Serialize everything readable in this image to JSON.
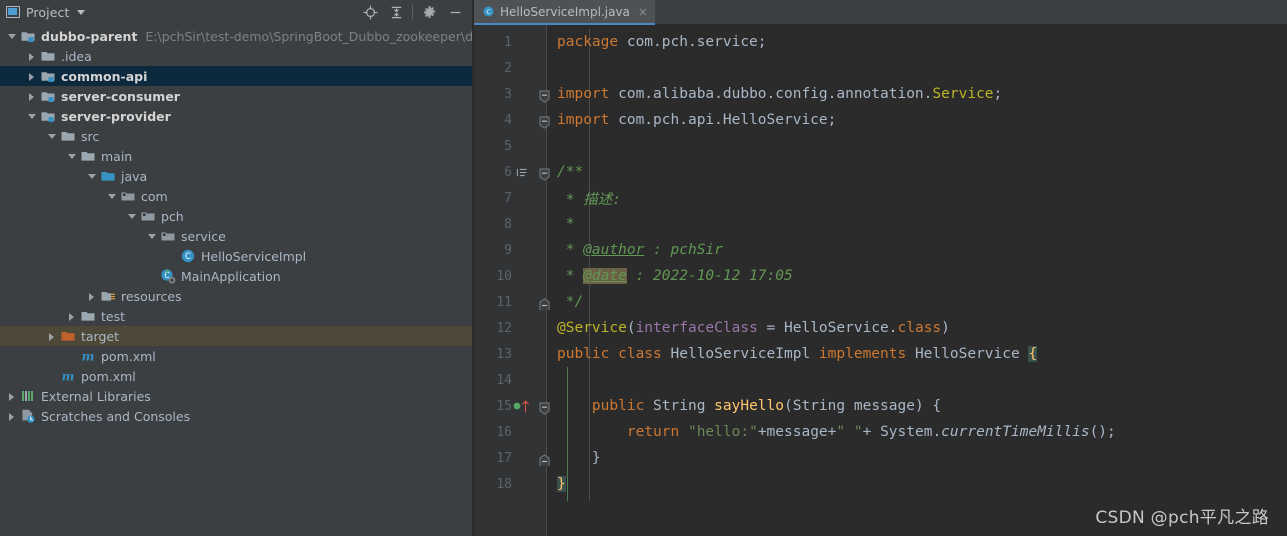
{
  "toolwindow": {
    "title": "Project",
    "icons": {
      "project_icon": "project-panel-icon",
      "caret": "chevron-down-icon",
      "locate": "locate-target-icon",
      "collapse": "collapse-all-icon",
      "settings": "gear-icon",
      "hide": "minimize-icon"
    }
  },
  "tree": [
    {
      "depth": 0,
      "arrow": "down",
      "icon": "module-icon",
      "label": "dubbo-parent",
      "bold": true,
      "hint": "E:\\pchSir\\test-demo\\SpringBoot_Dubbo_zookeeper\\dubbo",
      "state": "normal"
    },
    {
      "depth": 1,
      "arrow": "right",
      "icon": "folder-icon",
      "label": ".idea",
      "bold": false,
      "hint": "",
      "state": "normal"
    },
    {
      "depth": 1,
      "arrow": "right",
      "icon": "module-icon",
      "label": "common-api",
      "bold": true,
      "hint": "",
      "state": "selected"
    },
    {
      "depth": 1,
      "arrow": "right",
      "icon": "module-icon",
      "label": "server-consumer",
      "bold": true,
      "hint": "",
      "state": "normal"
    },
    {
      "depth": 1,
      "arrow": "down",
      "icon": "module-icon",
      "label": "server-provider",
      "bold": true,
      "hint": "",
      "state": "normal"
    },
    {
      "depth": 2,
      "arrow": "down",
      "icon": "folder-icon",
      "label": "src",
      "bold": false,
      "hint": "",
      "state": "normal"
    },
    {
      "depth": 3,
      "arrow": "down",
      "icon": "folder-icon",
      "label": "main",
      "bold": false,
      "hint": "",
      "state": "normal"
    },
    {
      "depth": 4,
      "arrow": "down",
      "icon": "source-folder-icon",
      "label": "java",
      "bold": false,
      "hint": "",
      "state": "normal"
    },
    {
      "depth": 5,
      "arrow": "down",
      "icon": "package-icon",
      "label": "com",
      "bold": false,
      "hint": "",
      "state": "normal"
    },
    {
      "depth": 6,
      "arrow": "down",
      "icon": "package-icon",
      "label": "pch",
      "bold": false,
      "hint": "",
      "state": "normal"
    },
    {
      "depth": 7,
      "arrow": "down",
      "icon": "package-icon",
      "label": "service",
      "bold": false,
      "hint": "",
      "state": "normal"
    },
    {
      "depth": 8,
      "arrow": "none",
      "icon": "java-class-icon",
      "label": "HelloServiceImpl",
      "bold": false,
      "hint": "",
      "state": "normal"
    },
    {
      "depth": 7,
      "arrow": "none",
      "icon": "runnable-class-icon",
      "label": "MainApplication",
      "bold": false,
      "hint": "",
      "state": "normal"
    },
    {
      "depth": 4,
      "arrow": "right",
      "icon": "resources-folder-icon",
      "label": "resources",
      "bold": false,
      "hint": "",
      "state": "normal"
    },
    {
      "depth": 3,
      "arrow": "right",
      "icon": "folder-icon",
      "label": "test",
      "bold": false,
      "hint": "",
      "state": "normal"
    },
    {
      "depth": 2,
      "arrow": "right",
      "icon": "target-folder-icon",
      "label": "target",
      "bold": false,
      "hint": "",
      "state": "highlighted"
    },
    {
      "depth": 3,
      "arrow": "none",
      "icon": "maven-pom-icon",
      "label": "pom.xml",
      "bold": false,
      "hint": "",
      "state": "normal"
    },
    {
      "depth": 2,
      "arrow": "none",
      "icon": "maven-pom-icon",
      "label": "pom.xml",
      "bold": false,
      "hint": "",
      "state": "normal"
    },
    {
      "depth": 0,
      "arrow": "right",
      "icon": "external-libraries-icon",
      "label": "External Libraries",
      "bold": false,
      "hint": "",
      "state": "normal"
    },
    {
      "depth": 0,
      "arrow": "right",
      "icon": "scratches-icon",
      "label": "Scratches and Consoles",
      "bold": false,
      "hint": "",
      "state": "normal"
    }
  ],
  "editor": {
    "tab": {
      "label": "HelloServiceImpl.java",
      "icon": "java-class-icon",
      "close": "×"
    },
    "lines": [
      {
        "num": "1",
        "fold": "none",
        "gutter": "none"
      },
      {
        "num": "2",
        "fold": "none",
        "gutter": "none"
      },
      {
        "num": "3",
        "fold": "minus",
        "gutter": "none"
      },
      {
        "num": "4",
        "fold": "minus",
        "gutter": "none"
      },
      {
        "num": "5",
        "fold": "none",
        "gutter": "none"
      },
      {
        "num": "6",
        "fold": "minus",
        "gutter": "doc"
      },
      {
        "num": "7",
        "fold": "none",
        "gutter": "none"
      },
      {
        "num": "8",
        "fold": "none",
        "gutter": "none"
      },
      {
        "num": "9",
        "fold": "none",
        "gutter": "none"
      },
      {
        "num": "10",
        "fold": "none",
        "gutter": "none"
      },
      {
        "num": "11",
        "fold": "end",
        "gutter": "none"
      },
      {
        "num": "12",
        "fold": "none",
        "gutter": "none"
      },
      {
        "num": "13",
        "fold": "none",
        "gutter": "none"
      },
      {
        "num": "14",
        "fold": "none",
        "gutter": "none"
      },
      {
        "num": "15",
        "fold": "minus",
        "gutter": "impl"
      },
      {
        "num": "16",
        "fold": "none",
        "gutter": "none"
      },
      {
        "num": "17",
        "fold": "end",
        "gutter": "none"
      },
      {
        "num": "18",
        "fold": "none",
        "gutter": "none"
      }
    ],
    "code": {
      "l1_kw": "package",
      "l1_rest": " com.pch.service;",
      "l3_kw": "import",
      "l3_pkg": " com.alibaba.dubbo.config.annotation.",
      "l3_cls": "Service",
      "l3_semi": ";",
      "l4_kw": "import",
      "l4_rest": " com.pch.api.HelloService;",
      "l6": "/**",
      "l7": " * 描述:",
      "l8": " *",
      "l9_star": " * ",
      "l9_tag": "@author",
      "l9_rest": " : pchSir",
      "l10_star": " * ",
      "l10_tag": "@date",
      "l10_rest": " : 2022-10-12 17:05",
      "l11": " */",
      "l12_anno": "@Service",
      "l12_p1": "(",
      "l12_attr": "interfaceClass",
      "l12_eq": " = ",
      "l12_cls": "HelloService",
      "l12_dot": ".",
      "l12_classkw": "class",
      "l12_p2": ")",
      "l13_kw1": "public",
      "l13_kw2": " class",
      "l13_name": " HelloServiceImpl",
      "l13_kw3": " implements",
      "l13_iface": " HelloService ",
      "l13_brace": "{",
      "l15_kw": "public",
      "l15_type": " String ",
      "l15_meth": "sayHello",
      "l15_p1": "(",
      "l15_ptype": "String",
      "l15_pname": " message",
      "l15_p2": ") {",
      "l16_kw": "return",
      "l16_s1": " \"hello:\"",
      "l16_plus1": "+message+",
      "l16_s2": "\" \"",
      "l16_plus2": "+ ",
      "l16_sys": "System.",
      "l16_static": "currentTimeMillis",
      "l16_end": "();",
      "l17": "}",
      "l18_brace": "}"
    }
  },
  "watermark": "CSDN @pch平凡之路",
  "colors": {
    "accent": "#4a88c7",
    "selection": "#0d293e",
    "highlight": "#4e4838",
    "editor_bg": "#2b2b2b",
    "panel_bg": "#3c3f41",
    "gutter_bg": "#313335",
    "keyword": "#cc7832",
    "string": "#6a8759",
    "comment": "#629755",
    "annotation": "#bbb529",
    "method": "#ffc66d",
    "field": "#9876aa"
  }
}
